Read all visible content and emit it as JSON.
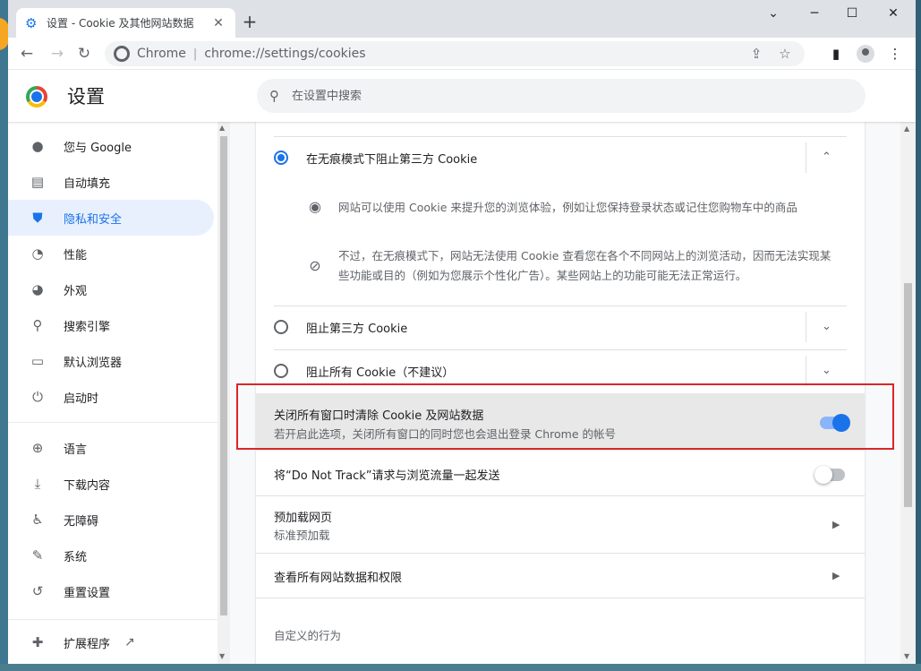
{
  "browser": {
    "tab_title": "设置 - Cookie 及其他网站数据",
    "omnibox_scheme": "Chrome",
    "omnibox_url": "chrome://settings/cookies",
    "accent_color": "#1a73e8"
  },
  "header": {
    "title": "设置",
    "search_placeholder": "在设置中搜索"
  },
  "sidebar": {
    "items": [
      {
        "label": "您与 Google",
        "icon": "person-icon"
      },
      {
        "label": "自动填充",
        "icon": "clipboard-icon"
      },
      {
        "label": "隐私和安全",
        "icon": "shield-icon",
        "active": true
      },
      {
        "label": "性能",
        "icon": "speedometer-icon"
      },
      {
        "label": "外观",
        "icon": "palette-icon"
      },
      {
        "label": "搜索引擎",
        "icon": "search-icon"
      },
      {
        "label": "默认浏览器",
        "icon": "browser-icon"
      },
      {
        "label": "启动时",
        "icon": "power-icon"
      },
      {
        "label": "语言",
        "icon": "globe-icon"
      },
      {
        "label": "下载内容",
        "icon": "download-icon"
      },
      {
        "label": "无障碍",
        "icon": "accessibility-icon"
      },
      {
        "label": "系统",
        "icon": "wrench-icon"
      },
      {
        "label": "重置设置",
        "icon": "history-icon"
      },
      {
        "label": "扩展程序",
        "icon": "puzzle-icon"
      }
    ]
  },
  "main": {
    "options": [
      {
        "label": "在无痕模式下阻止第三方 Cookie",
        "checked": true,
        "expanded": true
      },
      {
        "label": "阻止第三方 Cookie",
        "checked": false
      },
      {
        "label": "阻止所有 Cookie（不建议）",
        "checked": false
      }
    ],
    "desc1": "网站可以使用 Cookie 来提升您的浏览体验，例如让您保持登录状态或记住您购物车中的商品",
    "desc2_line1": "不过，在无痕模式下，网站无法使用 Cookie 查看您在各个不同网站上的浏览活动，因而无法实现某",
    "desc2_line2": "些功能或目的（例如为您展示个性化广告）。某些网站上的功能可能无法正常运行。",
    "clear_on_exit": {
      "title": "关闭所有窗口时清除 Cookie 及网站数据",
      "subtitle": "若开启此选项，关闭所有窗口的同时您也会退出登录 Chrome 的帐号",
      "enabled": true
    },
    "do_not_track": {
      "title": "将“Do Not Track”请求与浏览流量一起发送",
      "enabled": false
    },
    "preload": {
      "title": "预加载网页",
      "subtitle": "标准预加载"
    },
    "all_site_data": "查看所有网站数据和权限",
    "custom_behaviors": "自定义的行为"
  }
}
